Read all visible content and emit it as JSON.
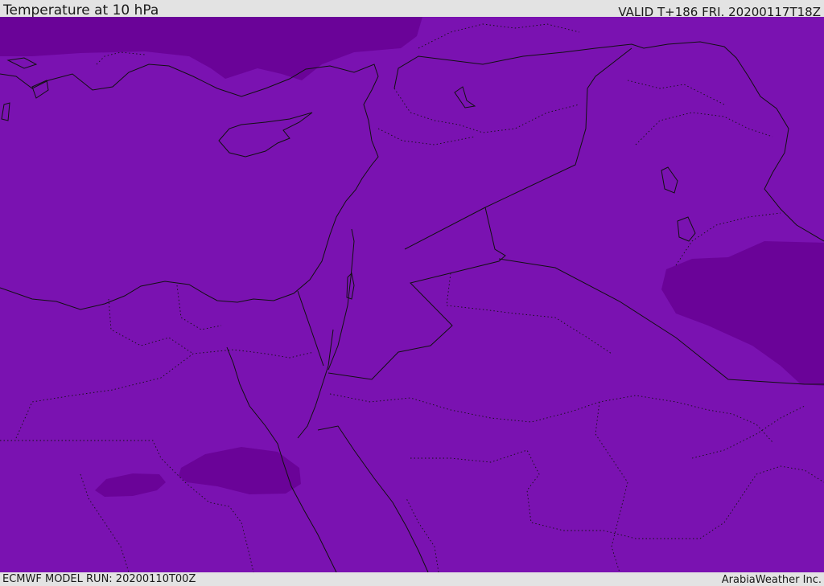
{
  "header": {
    "title": "Temperature at 10 hPa",
    "valid": "VALID T+186 FRI. 20200117T18Z"
  },
  "footer": {
    "model_run": "ECMWF MODEL RUN: 20200110T00Z",
    "credit": "ArabiaWeather Inc."
  },
  "map": {
    "field_color": "#7a12b1",
    "cold_patch_color": "#6a0398",
    "coastline_color": "#111111",
    "border_style": "dotted"
  }
}
